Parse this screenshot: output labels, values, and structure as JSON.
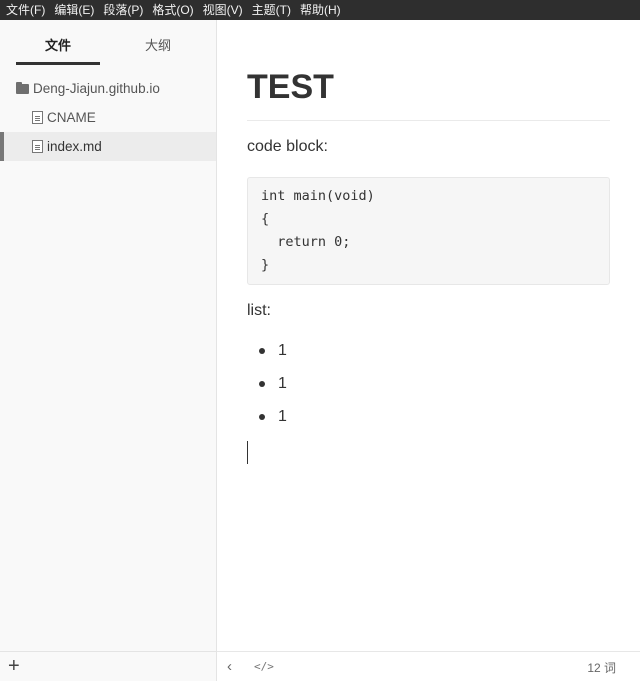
{
  "menubar": {
    "items": [
      "文件(F)",
      "编辑(E)",
      "段落(P)",
      "格式(O)",
      "视图(V)",
      "主题(T)",
      "帮助(H)"
    ]
  },
  "sidebar": {
    "tabs": [
      {
        "label": "文件",
        "active": true
      },
      {
        "label": "大纲",
        "active": false
      }
    ],
    "tree": {
      "folder": {
        "label": "Deng-Jiajun.github.io",
        "icon": "folder-icon"
      },
      "files": [
        {
          "label": "CNAME",
          "icon": "file-icon",
          "active": false
        },
        {
          "label": "index.md",
          "icon": "file-icon",
          "active": true
        }
      ]
    },
    "footer": {
      "add_icon": "+"
    }
  },
  "document": {
    "title": "TEST",
    "para1": "code block:",
    "code_lines": [
      "int main(void)",
      "{",
      "  return 0;",
      "}"
    ],
    "para2": "list:",
    "list_items": [
      "1",
      "1",
      "1"
    ]
  },
  "statusbar": {
    "back_icon": "‹",
    "source_icon": "</>",
    "word_count": "12 词"
  },
  "colors": {
    "menubar_bg": "#2e2e2e",
    "sidebar_bg": "#f9f9f9",
    "code_bg": "#f6f6f6"
  }
}
